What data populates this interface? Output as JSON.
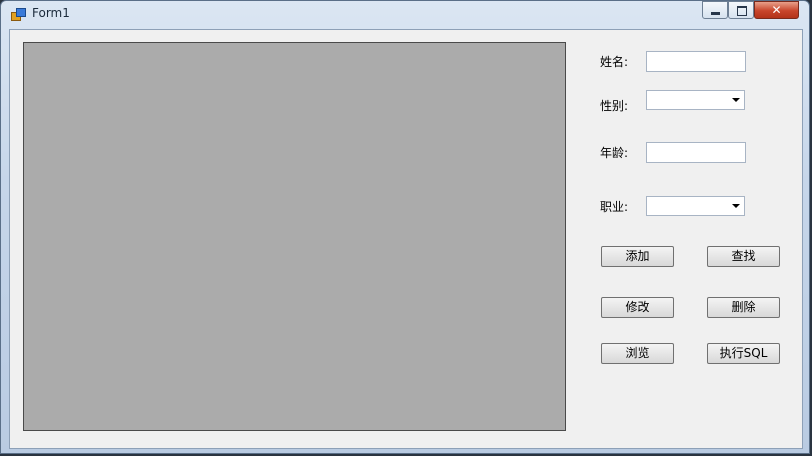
{
  "window": {
    "title": "Form1"
  },
  "form": {
    "name_label": "姓名:",
    "gender_label": "性别:",
    "age_label": "年龄:",
    "job_label": "职业:",
    "name_value": "",
    "age_value": "",
    "gender_selected": "",
    "job_selected": ""
  },
  "buttons": {
    "add": "添加",
    "find": "查找",
    "edit": "修改",
    "delete": "删除",
    "browse": "浏览",
    "exec_sql": "执行SQL"
  },
  "icons": {
    "app": "winforms-app-icon",
    "minimize": "minimize-icon",
    "maximize": "maximize-icon",
    "close": "close-icon"
  }
}
